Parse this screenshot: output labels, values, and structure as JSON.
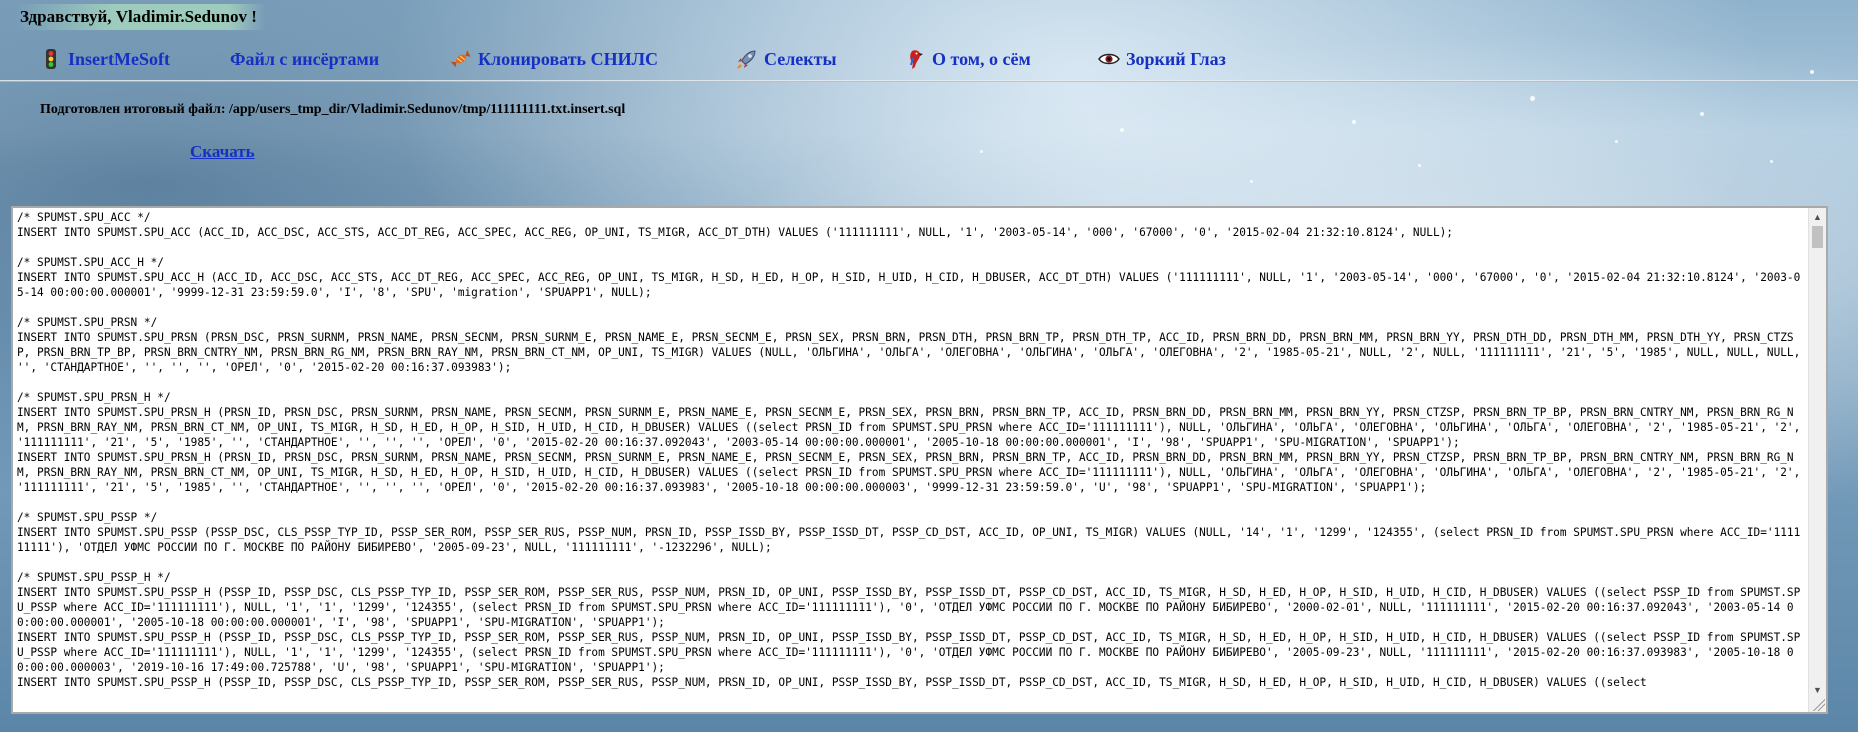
{
  "greeting": "Здравствуй, Vladimir.Sedunov !",
  "nav": {
    "items": [
      {
        "label": "InsertMeSoft",
        "icon": "traffic-light-icon"
      },
      {
        "label": "Файл с инсёртами",
        "icon": ""
      },
      {
        "label": "Клонировать СНИЛС",
        "icon": "candy-icon"
      },
      {
        "label": "Селекты",
        "icon": "rocket-icon"
      },
      {
        "label": "О том, о сём",
        "icon": "parrot-icon"
      },
      {
        "label": "Зоркий Глаз",
        "icon": "eye-icon"
      }
    ]
  },
  "file_status": "Подготовлен итоговый файл: /app/users_tmp_dir/Vladimir.Sedunov/tmp/111111111.txt.insert.sql",
  "download_label": "Скачать",
  "sql_output": "/* SPUMST.SPU_ACC */\nINSERT INTO SPUMST.SPU_ACC (ACC_ID, ACC_DSC, ACC_STS, ACC_DT_REG, ACC_SPEC, ACC_REG, OP_UNI, TS_MIGR, ACC_DT_DTH) VALUES ('111111111', NULL, '1', '2003-05-14', '000', '67000', '0', '2015-02-04 21:32:10.8124', NULL);\n\n/* SPUMST.SPU_ACC_H */\nINSERT INTO SPUMST.SPU_ACC_H (ACC_ID, ACC_DSC, ACC_STS, ACC_DT_REG, ACC_SPEC, ACC_REG, OP_UNI, TS_MIGR, H_SD, H_ED, H_OP, H_SID, H_UID, H_CID, H_DBUSER, ACC_DT_DTH) VALUES ('111111111', NULL, '1', '2003-05-14', '000', '67000', '0', '2015-02-04 21:32:10.8124', '2003-05-14 00:00:00.000001', '9999-12-31 23:59:59.0', 'I', '8', 'SPU', 'migration', 'SPUAPP1', NULL);\n\n/* SPUMST.SPU_PRSN */\nINSERT INTO SPUMST.SPU_PRSN (PRSN_DSC, PRSN_SURNM, PRSN_NAME, PRSN_SECNM, PRSN_SURNM_E, PRSN_NAME_E, PRSN_SECNM_E, PRSN_SEX, PRSN_BRN, PRSN_DTH, PRSN_BRN_TP, PRSN_DTH_TP, ACC_ID, PRSN_BRN_DD, PRSN_BRN_MM, PRSN_BRN_YY, PRSN_DTH_DD, PRSN_DTH_MM, PRSN_DTH_YY, PRSN_CTZSP, PRSN_BRN_TP_BP, PRSN_BRN_CNTRY_NM, PRSN_BRN_RG_NM, PRSN_BRN_RAY_NM, PRSN_BRN_CT_NM, OP_UNI, TS_MIGR) VALUES (NULL, 'ОЛЬГИНА', 'ОЛЬГА', 'ОЛЕГОВНА', 'ОЛЬГИНА', 'ОЛЬГА', 'ОЛЕГОВНА', '2', '1985-05-21', NULL, '2', NULL, '111111111', '21', '5', '1985', NULL, NULL, NULL, '', 'СТАНДАРТНОЕ', '', '', '', 'ОРЕЛ', '0', '2015-02-20 00:16:37.093983');\n\n/* SPUMST.SPU_PRSN_H */\nINSERT INTO SPUMST.SPU_PRSN_H (PRSN_ID, PRSN_DSC, PRSN_SURNM, PRSN_NAME, PRSN_SECNM, PRSN_SURNM_E, PRSN_NAME_E, PRSN_SECNM_E, PRSN_SEX, PRSN_BRN, PRSN_BRN_TP, ACC_ID, PRSN_BRN_DD, PRSN_BRN_MM, PRSN_BRN_YY, PRSN_CTZSP, PRSN_BRN_TP_BP, PRSN_BRN_CNTRY_NM, PRSN_BRN_RG_NM, PRSN_BRN_RAY_NM, PRSN_BRN_CT_NM, OP_UNI, TS_MIGR, H_SD, H_ED, H_OP, H_SID, H_UID, H_CID, H_DBUSER) VALUES ((select PRSN_ID from SPUMST.SPU_PRSN where ACC_ID='111111111'), NULL, 'ОЛЬГИНА', 'ОЛЬГА', 'ОЛЕГОВНА', 'ОЛЬГИНА', 'ОЛЬГА', 'ОЛЕГОВНА', '2', '1985-05-21', '2', '111111111', '21', '5', '1985', '', 'СТАНДАРТНОЕ', '', '', '', 'ОРЕЛ', '0', '2015-02-20 00:16:37.092043', '2003-05-14 00:00:00.000001', '2005-10-18 00:00:00.000001', 'I', '98', 'SPUAPP1', 'SPU-MIGRATION', 'SPUAPP1');\nINSERT INTO SPUMST.SPU_PRSN_H (PRSN_ID, PRSN_DSC, PRSN_SURNM, PRSN_NAME, PRSN_SECNM, PRSN_SURNM_E, PRSN_NAME_E, PRSN_SECNM_E, PRSN_SEX, PRSN_BRN, PRSN_BRN_TP, ACC_ID, PRSN_BRN_DD, PRSN_BRN_MM, PRSN_BRN_YY, PRSN_CTZSP, PRSN_BRN_TP_BP, PRSN_BRN_CNTRY_NM, PRSN_BRN_RG_NM, PRSN_BRN_RAY_NM, PRSN_BRN_CT_NM, OP_UNI, TS_MIGR, H_SD, H_ED, H_OP, H_SID, H_UID, H_CID, H_DBUSER) VALUES ((select PRSN_ID from SPUMST.SPU_PRSN where ACC_ID='111111111'), NULL, 'ОЛЬГИНА', 'ОЛЬГА', 'ОЛЕГОВНА', 'ОЛЬГИНА', 'ОЛЬГА', 'ОЛЕГОВНА', '2', '1985-05-21', '2', '111111111', '21', '5', '1985', '', 'СТАНДАРТНОЕ', '', '', '', 'ОРЕЛ', '0', '2015-02-20 00:16:37.093983', '2005-10-18 00:00:00.000003', '9999-12-31 23:59:59.0', 'U', '98', 'SPUAPP1', 'SPU-MIGRATION', 'SPUAPP1');\n\n/* SPUMST.SPU_PSSP */\nINSERT INTO SPUMST.SPU_PSSP (PSSP_DSC, CLS_PSSP_TYP_ID, PSSP_SER_ROM, PSSP_SER_RUS, PSSP_NUM, PRSN_ID, PSSP_ISSD_BY, PSSP_ISSD_DT, PSSP_CD_DST, ACC_ID, OP_UNI, TS_MIGR) VALUES (NULL, '14', '1', '1299', '124355', (select PRSN_ID from SPUMST.SPU_PRSN where ACC_ID='111111111'), 'ОТДЕЛ УФМС РОССИИ ПО Г. МОСКВЕ ПО РАЙОНУ БИБИРЕВО', '2005-09-23', NULL, '111111111', '-1232296', NULL);\n\n/* SPUMST.SPU_PSSP_H */\nINSERT INTO SPUMST.SPU_PSSP_H (PSSP_ID, PSSP_DSC, CLS_PSSP_TYP_ID, PSSP_SER_ROM, PSSP_SER_RUS, PSSP_NUM, PRSN_ID, OP_UNI, PSSP_ISSD_BY, PSSP_ISSD_DT, PSSP_CD_DST, ACC_ID, TS_MIGR, H_SD, H_ED, H_OP, H_SID, H_UID, H_CID, H_DBUSER) VALUES ((select PSSP_ID from SPUMST.SPU_PSSP where ACC_ID='111111111'), NULL, '1', '1', '1299', '124355', (select PRSN_ID from SPUMST.SPU_PRSN where ACC_ID='111111111'), '0', 'ОТДЕЛ УФМС РОССИИ ПО Г. МОСКВЕ ПО РАЙОНУ БИБИРЕВО', '2000-02-01', NULL, '111111111', '2015-02-20 00:16:37.092043', '2003-05-14 00:00:00.000001', '2005-10-18 00:00:00.000001', 'I', '98', 'SPUAPP1', 'SPU-MIGRATION', 'SPUAPP1');\nINSERT INTO SPUMST.SPU_PSSP_H (PSSP_ID, PSSP_DSC, CLS_PSSP_TYP_ID, PSSP_SER_ROM, PSSP_SER_RUS, PSSP_NUM, PRSN_ID, OP_UNI, PSSP_ISSD_BY, PSSP_ISSD_DT, PSSP_CD_DST, ACC_ID, TS_MIGR, H_SD, H_ED, H_OP, H_SID, H_UID, H_CID, H_DBUSER) VALUES ((select PSSP_ID from SPUMST.SPU_PSSP where ACC_ID='111111111'), NULL, '1', '1', '1299', '124355', (select PRSN_ID from SPUMST.SPU_PRSN where ACC_ID='111111111'), '0', 'ОТДЕЛ УФМС РОССИИ ПО Г. МОСКВЕ ПО РАЙОНУ БИБИРЕВО', '2005-09-23', NULL, '111111111', '2015-02-20 00:16:37.093983', '2005-10-18 00:00:00.000003', '2019-10-16 17:49:00.725788', 'U', '98', 'SPUAPP1', 'SPU-MIGRATION', 'SPUAPP1');\nINSERT INTO SPUMST.SPU_PSSP_H (PSSP_ID, PSSP_DSC, CLS_PSSP_TYP_ID, PSSP_SER_ROM, PSSP_SER_RUS, PSSP_NUM, PRSN_ID, OP_UNI, PSSP_ISSD_BY, PSSP_ISSD_DT, PSSP_CD_DST, ACC_ID, TS_MIGR, H_SD, H_ED, H_OP, H_SID, H_UID, H_CID, H_DBUSER) VALUES ((select"
}
